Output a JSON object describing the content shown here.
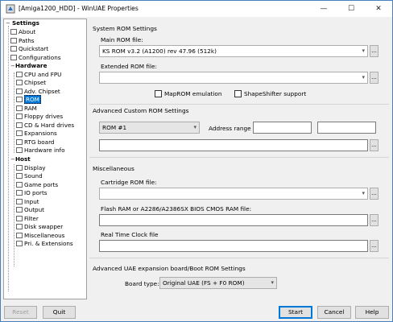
{
  "window": {
    "title": "[Amiga1200_HDD] - WinUAE Properties",
    "minimize_icon": "minimize-icon",
    "maximize_icon": "maximize-icon",
    "close_icon": "close-icon",
    "minimize_glyph": "—",
    "maximize_glyph": "☐",
    "close_glyph": "✕"
  },
  "tree": {
    "settings": "Settings",
    "about": "About",
    "paths": "Paths",
    "quickstart": "Quickstart",
    "configurations": "Configurations",
    "hardware": "Hardware",
    "cpu": "CPU and FPU",
    "chipset": "Chipset",
    "adv_chipset": "Adv. Chipset",
    "rom": "ROM",
    "ram": "RAM",
    "floppy": "Floppy drives",
    "cd_hd": "CD & Hard drives",
    "expansions": "Expansions",
    "rtg": "RTG board",
    "hwinfo": "Hardware info",
    "host": "Host",
    "display": "Display",
    "sound": "Sound",
    "gameports": "Game ports",
    "ioports": "IO ports",
    "input": "Input",
    "output": "Output",
    "filter": "Filter",
    "diskswapper": "Disk swapper",
    "misc": "Miscellaneous",
    "pri": "Pri. & Extensions",
    "selected": "ROM"
  },
  "rom": {
    "section_system": "System ROM Settings",
    "main_rom_label": "Main ROM file:",
    "main_rom_value": "KS ROM v3.2 (A1200) rev 47.96 (512k)",
    "ext_rom_label": "Extended ROM file:",
    "ext_rom_value": "",
    "maprom_label": "MapROM emulation",
    "shapeshifter_label": "ShapeShifter support",
    "section_custom": "Advanced Custom ROM Settings",
    "custom_rom_select": "ROM #1",
    "address_range_label": "Address range",
    "section_misc": "Miscellaneous",
    "cart_label": "Cartridge ROM file:",
    "flash_label": "Flash RAM or A2286/A2386SX BIOS CMOS RAM file:",
    "rtc_label": "Real Time Clock file",
    "section_uae": "Advanced UAE expansion board/Boot ROM Settings",
    "board_type_label": "Board type:",
    "board_type_value": "Original UAE (FS + F0 ROM)",
    "browse": "..."
  },
  "buttons": {
    "reset": "Reset",
    "quit": "Quit",
    "start": "Start",
    "cancel": "Cancel",
    "help": "Help"
  },
  "colors": {
    "selection": "#0078d7",
    "accent_border": "#0078d7"
  }
}
